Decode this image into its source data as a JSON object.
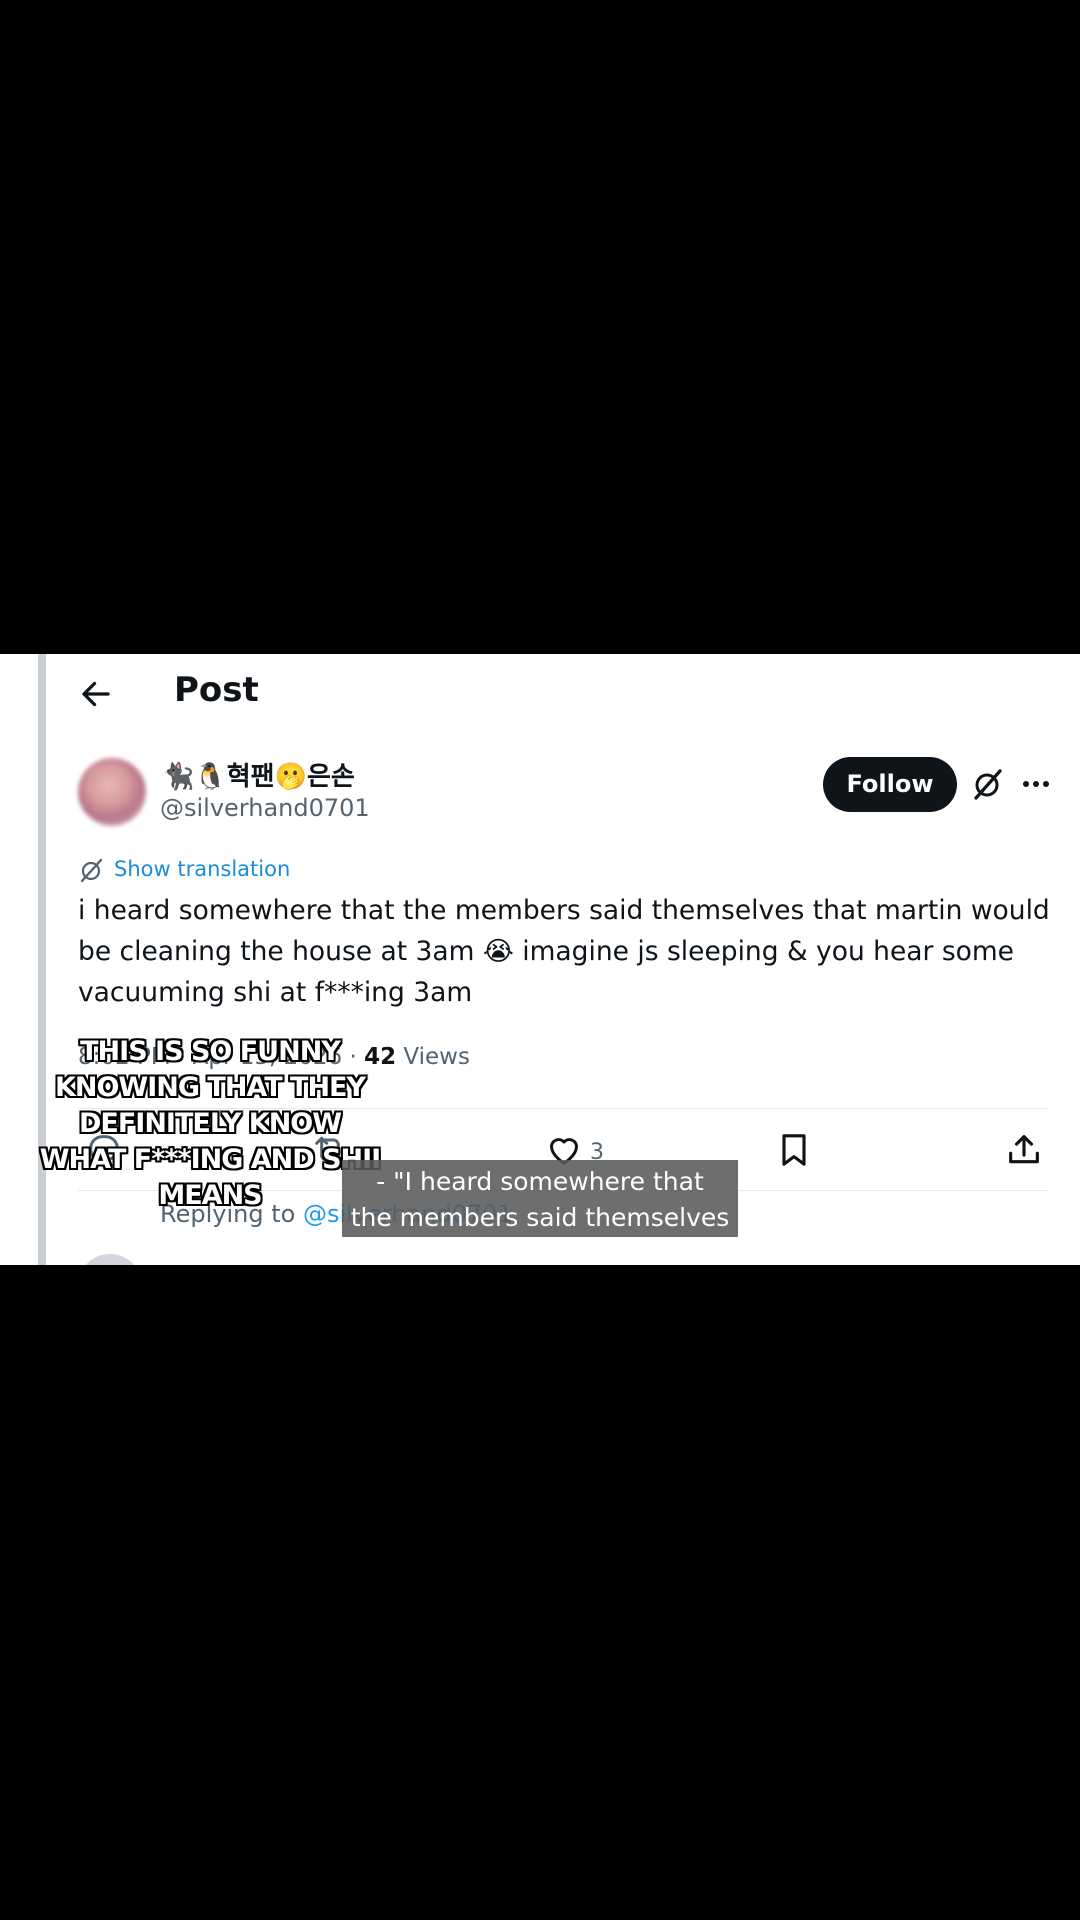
{
  "header": {
    "title": "Post"
  },
  "author": {
    "display_name": "🐈‍⬛🐧혁팬🫢은손",
    "handle": "@silverhand0701"
  },
  "buttons": {
    "follow_label": "Follow"
  },
  "translation": {
    "label": "Show translation"
  },
  "tweet": {
    "text": "i heard somewhere that the members said themselves that martin would be cleaning the house at 3am 😭 imagine js sleeping & you hear some vacuuming shi at f***ing 3am",
    "timestamp": "8:02 PM · Apr 13, 2026",
    "views_count": "42",
    "views_label": "Views",
    "likes": "3"
  },
  "reply": {
    "prefix": "Replying to",
    "handle": "@silverhand0701"
  },
  "overlay": {
    "caption_line1": "THIS IS SO FUNNY",
    "caption_line2": "KNOWING THAT THEY",
    "caption_line3": "DEFINITELY KNOW",
    "caption_line4": "WHAT F***ING AND SHII",
    "caption_line5": "MEANS",
    "subtitle_line1": "- \"I heard somewhere that",
    "subtitle_line2": "the members said themselves"
  },
  "icons": {
    "back": "arrow-left-icon",
    "grok": "grok-icon",
    "more": "more-horizontal-icon",
    "reply": "reply-icon",
    "repost": "repost-icon",
    "like": "heart-icon",
    "bookmark": "bookmark-icon",
    "share": "share-icon"
  },
  "colors": {
    "accent": "#1d9bf0",
    "follow_bg": "#0f1419",
    "text": "#0f1419",
    "muted": "#536471"
  }
}
